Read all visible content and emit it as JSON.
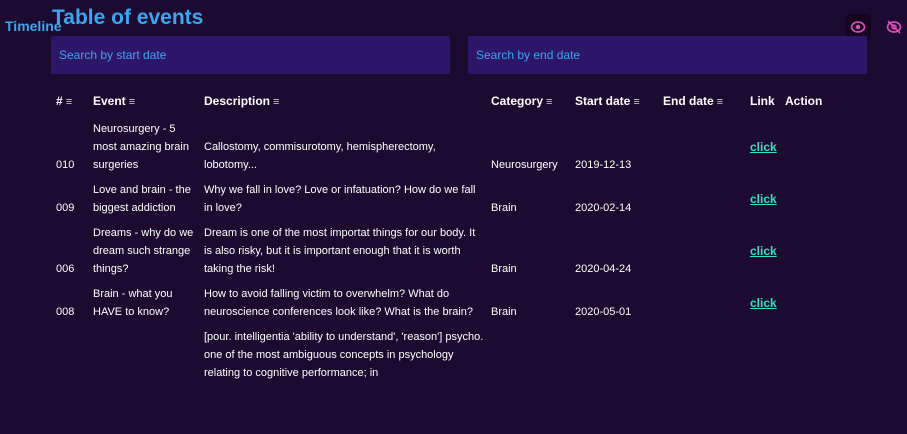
{
  "header": {
    "tab_label": "Timeline",
    "title": "Table of events",
    "icons": [
      "eye-icon",
      "eye-off-icon"
    ],
    "accent_color": "#3aa6f0"
  },
  "search": {
    "start_placeholder": "Search by start date",
    "end_placeholder": "Search by end date",
    "start_value": "",
    "end_value": ""
  },
  "table": {
    "columns": [
      {
        "label": "#",
        "sortable": true
      },
      {
        "label": "Event",
        "sortable": true
      },
      {
        "label": "Description",
        "sortable": true
      },
      {
        "label": "Category",
        "sortable": true
      },
      {
        "label": "Start date",
        "sortable": true
      },
      {
        "label": "End date",
        "sortable": true
      },
      {
        "label": "Link",
        "sortable": false
      },
      {
        "label": "Action",
        "sortable": false
      }
    ],
    "sort_glyph": "≡",
    "rows": [
      {
        "id": "010",
        "event": "Neurosurgery - 5 most amazing brain surgeries",
        "description": "Callostomy, commisurotomy, hemispherectomy, lobotomy...",
        "category": "Neurosurgery",
        "start_date": "2019-12-13",
        "end_date": "",
        "link": "click"
      },
      {
        "id": "009",
        "event": "Love and brain - the biggest addiction",
        "description": "Why we fall in love? Love or infatuation? How do we fall in love?",
        "category": "Brain",
        "start_date": "2020-02-14",
        "end_date": "",
        "link": "click"
      },
      {
        "id": "006",
        "event": "Dreams - why do we dream such strange things?",
        "description": "Dream is one of the most importat things for our body. It is also risky, but it is important enough that it is worth taking the risk!",
        "category": "Brain",
        "start_date": "2020-04-24",
        "end_date": "",
        "link": "click"
      },
      {
        "id": "008",
        "event": "Brain - what you HAVE to know?",
        "description": "How to avoid falling victim to overwhelm? What do neuroscience conferences look like? What is the brain?",
        "category": "Brain",
        "start_date": "2020-05-01",
        "end_date": "",
        "link": "click"
      },
      {
        "id": "",
        "event": "",
        "description": "[pour. intelligentia 'ability to understand', 'reason'] psycho. one of the most ambiguous concepts in psychology relating to cognitive performance; in",
        "category": "",
        "start_date": "",
        "end_date": "",
        "link": ""
      }
    ]
  }
}
